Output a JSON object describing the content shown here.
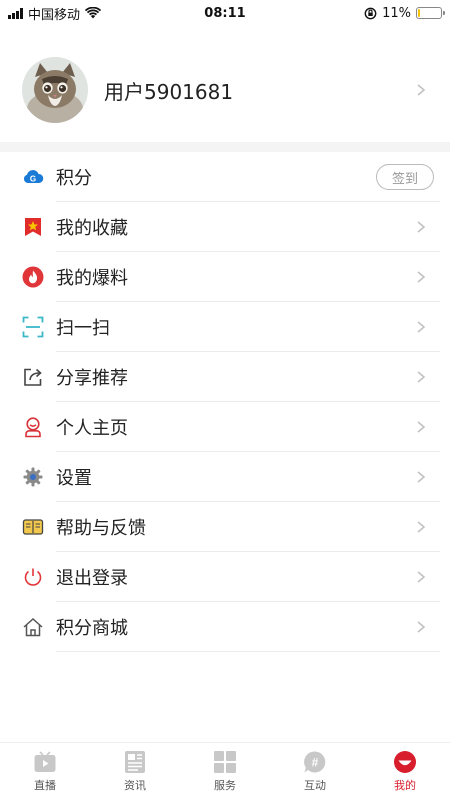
{
  "status_bar": {
    "carrier": "中国移动",
    "time": "08:11",
    "battery": "11%",
    "battery_level": 0.11
  },
  "profile": {
    "username": "用户5901681",
    "avatar_icon": "cat-avatar"
  },
  "menu": {
    "items": [
      {
        "label": "积分",
        "icon": "points-cloud-icon",
        "action": "签到"
      },
      {
        "label": "我的收藏",
        "icon": "bookmark-star-icon"
      },
      {
        "label": "我的爆料",
        "icon": "fire-icon"
      },
      {
        "label": "扫一扫",
        "icon": "scan-icon"
      },
      {
        "label": "分享推荐",
        "icon": "share-icon"
      },
      {
        "label": "个人主页",
        "icon": "person-icon"
      },
      {
        "label": "设置",
        "icon": "gear-icon"
      },
      {
        "label": "帮助与反馈",
        "icon": "help-book-icon"
      },
      {
        "label": "退出登录",
        "icon": "power-icon"
      },
      {
        "label": "积分商城",
        "icon": "home-store-icon"
      }
    ]
  },
  "tabbar": {
    "tabs": [
      {
        "label": "直播",
        "icon": "tv-icon"
      },
      {
        "label": "资讯",
        "icon": "news-icon"
      },
      {
        "label": "服务",
        "icon": "grid-icon"
      },
      {
        "label": "互动",
        "icon": "chat-hash-icon"
      },
      {
        "label": "我的",
        "icon": "me-icon",
        "active": true
      }
    ]
  },
  "colors": {
    "accent": "#d81e2d",
    "icon_blue": "#1a7bd6",
    "icon_teal": "#3bb8c8",
    "divider": "#f4f4f4"
  }
}
